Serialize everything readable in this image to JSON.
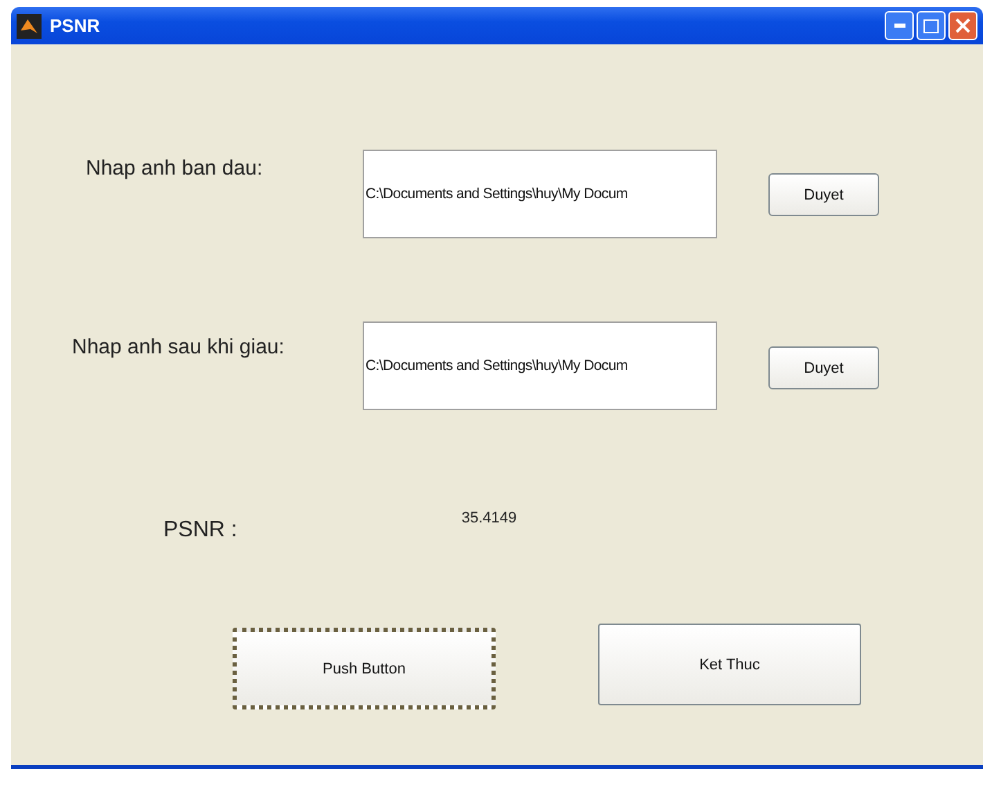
{
  "window": {
    "title": "PSNR"
  },
  "inputs": [
    {
      "label": "Nhap anh ban dau:",
      "value": "C:\\Documents and Settings\\huy\\My Docum",
      "button": "Duyet"
    },
    {
      "label": "Nhap anh sau khi giau:",
      "value": "C:\\Documents and Settings\\huy\\My Docum",
      "button": "Duyet"
    }
  ],
  "result": {
    "label": "PSNR :",
    "value": "35.4149"
  },
  "buttons": [
    {
      "label": "Push Button",
      "focused": true
    },
    {
      "label": "Ket Thuc",
      "focused": false
    }
  ]
}
